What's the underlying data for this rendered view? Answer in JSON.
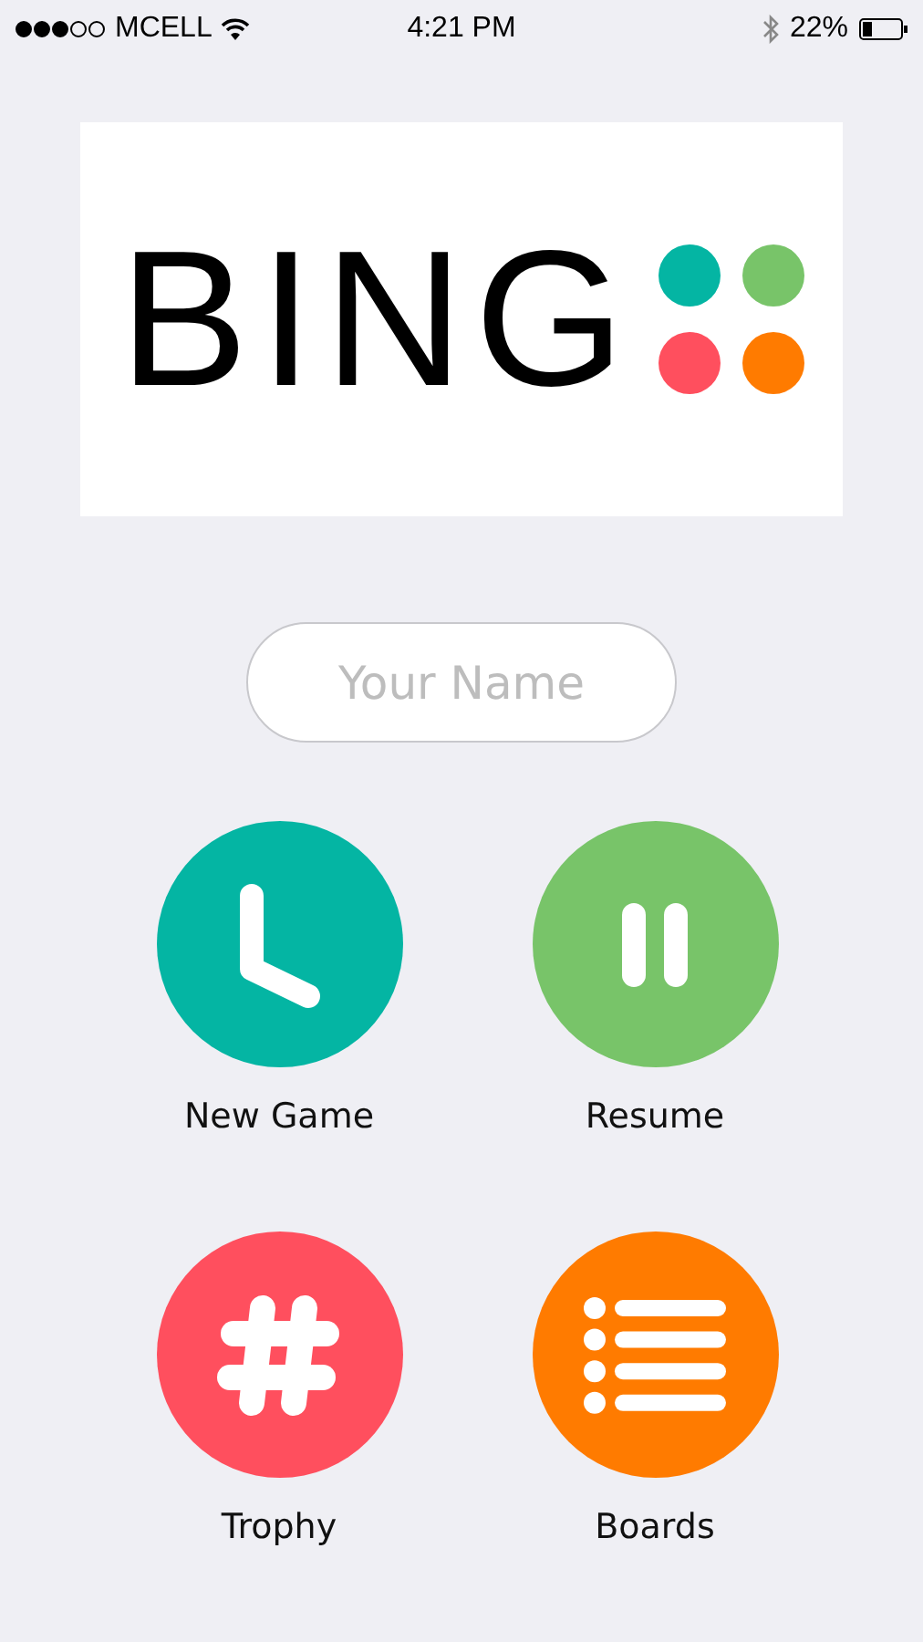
{
  "status_bar": {
    "carrier": "MCELL",
    "time": "4:21 PM",
    "battery": "22%"
  },
  "logo": {
    "text": "BING",
    "dots": [
      {
        "color": "#04b5a3"
      },
      {
        "color": "#78c469"
      },
      {
        "color": "#ff4f5e"
      },
      {
        "color": "#ff7b00"
      }
    ]
  },
  "name_field": {
    "placeholder": "Your Name"
  },
  "menu": [
    {
      "kind": "clock",
      "label": "New Game",
      "color": "#04b5a3"
    },
    {
      "kind": "pause",
      "label": "Resume",
      "color": "#78c469"
    },
    {
      "kind": "hash",
      "label": "Trophy",
      "color": "#ff4f5e"
    },
    {
      "kind": "list",
      "label": "Boards",
      "color": "#ff7b00"
    }
  ]
}
